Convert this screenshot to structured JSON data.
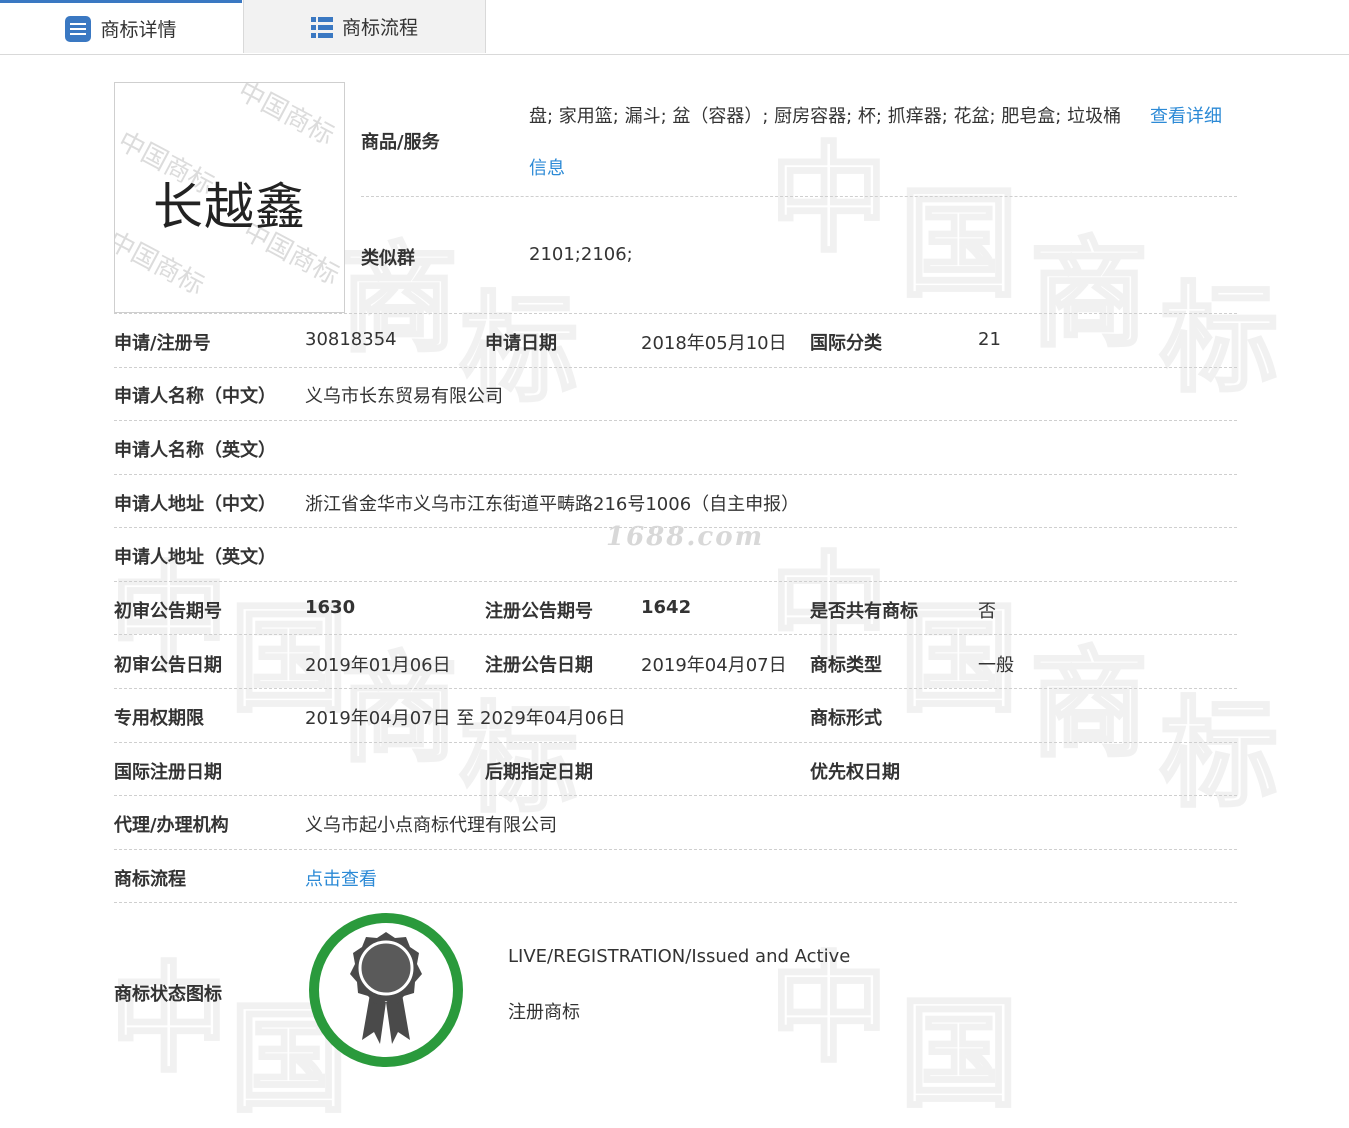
{
  "tabs": [
    {
      "label": "商标详情",
      "icon": "document-icon",
      "active": true
    },
    {
      "label": "商标流程",
      "icon": "list-icon",
      "active": false
    }
  ],
  "logo": {
    "text": "长越鑫",
    "watermark": "中国商标"
  },
  "goods": {
    "label": "商品/服务",
    "value": "盘; 家用篮; 漏斗; 盆（容器）; 厨房容器; 杯; 抓痒器; 花盆; 肥皂盒; 垃圾桶",
    "link_part1": "查看详细",
    "link_part2": "信息"
  },
  "similar": {
    "label": "类似群",
    "value": "2101;2106;"
  },
  "rows": {
    "reg_no": {
      "label": "申请/注册号",
      "value": "30818354"
    },
    "app_date": {
      "label": "申请日期",
      "value": "2018年05月10日"
    },
    "intl_class": {
      "label": "国际分类",
      "value": "21"
    },
    "applicant_cn": {
      "label": "申请人名称（中文）",
      "value": "义乌市长东贸易有限公司"
    },
    "applicant_en": {
      "label": "申请人名称（英文）",
      "value": ""
    },
    "address_cn": {
      "label": "申请人地址（中文）",
      "value": "浙江省金华市义乌市江东街道平畴路216号1006（自主申报）"
    },
    "address_en": {
      "label": "申请人地址（英文）",
      "value": ""
    },
    "prelim_no": {
      "label": "初审公告期号",
      "value": "1630"
    },
    "reg_pub_no": {
      "label": "注册公告期号",
      "value": "1642"
    },
    "shared": {
      "label": "是否共有商标",
      "value": "否"
    },
    "prelim_date": {
      "label": "初审公告日期",
      "value": "2019年01月06日"
    },
    "reg_pub_date": {
      "label": "注册公告日期",
      "value": "2019年04月07日"
    },
    "tm_type": {
      "label": "商标类型",
      "value": "一般"
    },
    "term": {
      "label": "专用权期限",
      "value": "2019年04月07日 至 2029年04月06日"
    },
    "tm_form": {
      "label": "商标形式",
      "value": ""
    },
    "intl_reg_date": {
      "label": "国际注册日期",
      "value": ""
    },
    "later_date": {
      "label": "后期指定日期",
      "value": ""
    },
    "priority_date": {
      "label": "优先权日期",
      "value": ""
    },
    "agent": {
      "label": "代理/办理机构",
      "value": "义乌市起小点商标代理有限公司"
    },
    "flow": {
      "label": "商标流程",
      "value": "点击查看"
    },
    "status": {
      "label": "商标状态图标",
      "en": "LIVE/REGISTRATION/Issued and Active",
      "cn": "注册商标"
    }
  },
  "watermark_site": "1688.com",
  "colors": {
    "accent": "#3a78c2",
    "link": "#2c8ad6",
    "emblem_ring": "#2a9a3c",
    "emblem_medal": "#4a4a4a"
  }
}
